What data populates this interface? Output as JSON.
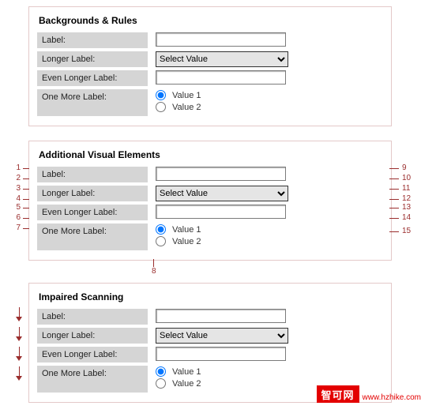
{
  "panels": {
    "p1": {
      "title": "Backgrounds & Rules",
      "rows": {
        "r1_label": "Label:",
        "r2_label": "Longer Label:",
        "r2_select": "Select Value",
        "r3_label": "Even Longer Label:",
        "r4_label": "One More Label:",
        "r4_opt1": "Value 1",
        "r4_opt2": "Value 2"
      }
    },
    "p2": {
      "title": "Additional Visual Elements",
      "rows": {
        "r1_label": "Label:",
        "r2_label": "Longer Label:",
        "r2_select": "Select Value",
        "r3_label": "Even Longer Label:",
        "r4_label": "One More Label:",
        "r4_opt1": "Value 1",
        "r4_opt2": "Value 2"
      },
      "ann_left": {
        "a1": "1",
        "a2": "2",
        "a3": "3",
        "a4": "4",
        "a5": "5",
        "a6": "6",
        "a7": "7"
      },
      "ann_right": {
        "a9": "9",
        "a10": "10",
        "a11": "11",
        "a12": "12",
        "a13": "13",
        "a14": "14",
        "a15": "15"
      },
      "ann_bottom": "8"
    },
    "p3": {
      "title": "Impaired Scanning",
      "rows": {
        "r1_label": "Label:",
        "r2_label": "Longer Label:",
        "r2_select": "Select Value",
        "r3_label": "Even Longer Label:",
        "r4_label": "One More Label:",
        "r4_opt1": "Value 1",
        "r4_opt2": "Value 2"
      }
    }
  },
  "footer": {
    "brand": "智可网",
    "url": "www.hzhike.com"
  }
}
